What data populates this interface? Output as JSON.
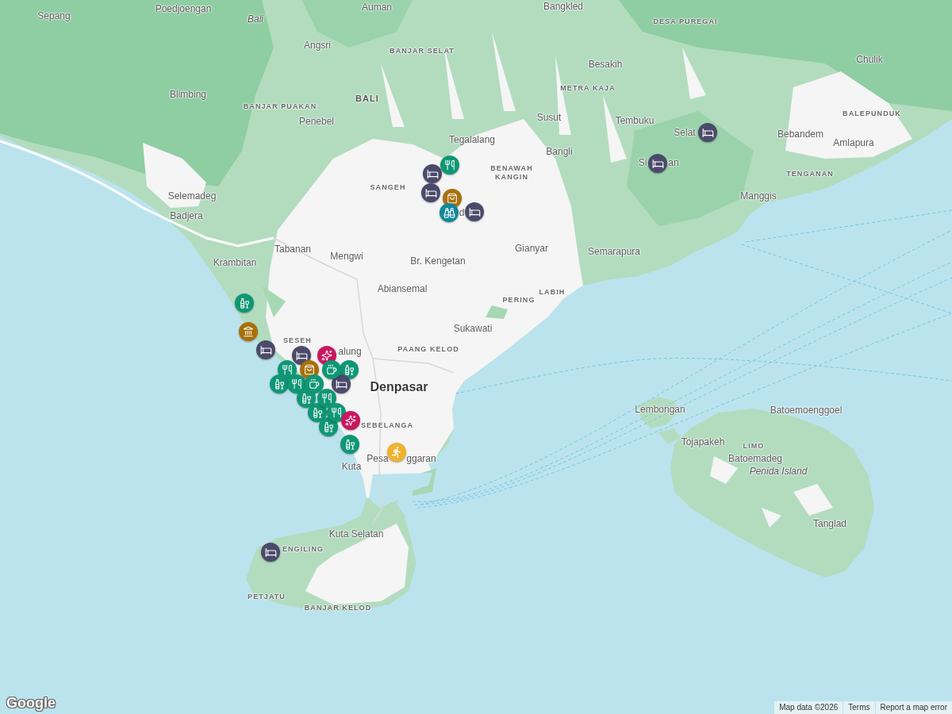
{
  "map": {
    "labels": [
      {
        "text": "Sepang",
        "kind": "town"
      },
      {
        "text": "Poedjoengan",
        "kind": "town"
      },
      {
        "text": "Bali",
        "kind": "region"
      },
      {
        "text": "Auman",
        "kind": "town"
      },
      {
        "text": "Bangkled",
        "kind": "town"
      },
      {
        "text": "DESA PUREGAI",
        "kind": "district"
      },
      {
        "text": "Angsri",
        "kind": "town"
      },
      {
        "text": "BANJAR SELAT",
        "kind": "district"
      },
      {
        "text": "Besakih",
        "kind": "town"
      },
      {
        "text": "Chulik",
        "kind": "town"
      },
      {
        "text": "Blimbing",
        "kind": "town"
      },
      {
        "text": "BANJAR PUAKAN",
        "kind": "district"
      },
      {
        "text": "BALI",
        "kind": "area"
      },
      {
        "text": "METRA KAJA",
        "kind": "district"
      },
      {
        "text": "Penebel",
        "kind": "town"
      },
      {
        "text": "Susut",
        "kind": "town"
      },
      {
        "text": "Tembuku",
        "kind": "town"
      },
      {
        "text": "BALEPUNDUK",
        "kind": "district"
      },
      {
        "text": "Tegalalang",
        "kind": "town"
      },
      {
        "text": "Bangli",
        "kind": "town"
      },
      {
        "text": "Selat",
        "kind": "town"
      },
      {
        "text": "Bebandem",
        "kind": "town"
      },
      {
        "text": "Amlapura",
        "kind": "town"
      },
      {
        "text": "BENAWAH KANGIN",
        "kind": "district"
      },
      {
        "text": "Si",
        "kind": "town"
      },
      {
        "text": "an",
        "kind": "town"
      },
      {
        "text": "TENGANAN",
        "kind": "district"
      },
      {
        "text": "Selemadeg",
        "kind": "town"
      },
      {
        "text": "SANGEH",
        "kind": "district"
      },
      {
        "text": "Manggis",
        "kind": "town"
      },
      {
        "text": "Badjera",
        "kind": "town"
      },
      {
        "text": "d",
        "kind": "town"
      },
      {
        "text": "Krambitan",
        "kind": "town"
      },
      {
        "text": "Tabanan",
        "kind": "town"
      },
      {
        "text": "Mengwi",
        "kind": "town"
      },
      {
        "text": "Br. Kengetan",
        "kind": "town"
      },
      {
        "text": "Gianyar",
        "kind": "town"
      },
      {
        "text": "Semarapura",
        "kind": "town"
      },
      {
        "text": "Abiansemal",
        "kind": "town"
      },
      {
        "text": "PERING",
        "kind": "district"
      },
      {
        "text": "LABIH",
        "kind": "district"
      },
      {
        "text": "Sukawati",
        "kind": "town"
      },
      {
        "text": "SESEH",
        "kind": "district"
      },
      {
        "text": "alung",
        "kind": "town"
      },
      {
        "text": "PAANG KELOD",
        "kind": "district"
      },
      {
        "text": "Denpasar",
        "kind": "city"
      },
      {
        "text": "Lembongan",
        "kind": "town"
      },
      {
        "text": "Batoemoenggoel",
        "kind": "town"
      },
      {
        "text": "SEBELANGA",
        "kind": "district"
      },
      {
        "text": "Tojapakeh",
        "kind": "town"
      },
      {
        "text": "LIMO",
        "kind": "district"
      },
      {
        "text": "Kuta",
        "kind": "town"
      },
      {
        "text": "Pesa",
        "kind": "town"
      },
      {
        "text": "ggaran",
        "kind": "town"
      },
      {
        "text": "Batoemadeg",
        "kind": "town"
      },
      {
        "text": "Penida Island",
        "kind": "region"
      },
      {
        "text": "Kuta Selatan",
        "kind": "town"
      },
      {
        "text": "Tanglad",
        "kind": "town"
      },
      {
        "text": "ENGILING",
        "kind": "district"
      },
      {
        "text": "PETJATU",
        "kind": "district"
      },
      {
        "text": "BANJAR KELOD",
        "kind": "district"
      }
    ],
    "markers": [
      {
        "kind": "hotel",
        "color": "#4c4a6b"
      },
      {
        "kind": "hotel",
        "color": "#4c4a6b"
      },
      {
        "kind": "restaurant",
        "color": "#0f9775"
      },
      {
        "kind": "hotel",
        "color": "#4c4a6b"
      },
      {
        "kind": "hotel",
        "color": "#4c4a6b"
      },
      {
        "kind": "shopping",
        "color": "#a8700a"
      },
      {
        "kind": "sightseeing",
        "color": "#13879a"
      },
      {
        "kind": "hotel",
        "color": "#4c4a6b"
      },
      {
        "kind": "bar",
        "color": "#0f9775"
      },
      {
        "kind": "museum",
        "color": "#a8700a"
      },
      {
        "kind": "hotel",
        "color": "#4c4a6b"
      },
      {
        "kind": "hotel",
        "color": "#4c4a6b"
      },
      {
        "kind": "spa",
        "color": "#c8175f"
      },
      {
        "kind": "restaurant",
        "color": "#0f9775"
      },
      {
        "kind": "bar",
        "color": "#0f9775"
      },
      {
        "kind": "shopping",
        "color": "#a8700a"
      },
      {
        "kind": "bar",
        "color": "#0f9775"
      },
      {
        "kind": "hotel",
        "color": "#4c4a6b"
      },
      {
        "kind": "restaurant",
        "color": "#0f9775"
      },
      {
        "kind": "cafe",
        "color": "#0f9775"
      },
      {
        "kind": "cafe",
        "color": "#0f9775"
      },
      {
        "kind": "bar",
        "color": "#0f9775"
      },
      {
        "kind": "bar",
        "color": "#0f9775"
      },
      {
        "kind": "restaurant",
        "color": "#0f9775"
      },
      {
        "kind": "bar",
        "color": "#0f9775"
      },
      {
        "kind": "restaurant",
        "color": "#0f9775"
      },
      {
        "kind": "spa",
        "color": "#c8175f"
      },
      {
        "kind": "bar",
        "color": "#0f9775"
      },
      {
        "kind": "activity",
        "color": "#f0b22e"
      },
      {
        "kind": "hotel",
        "color": "#4c4a6b"
      }
    ]
  },
  "logo": "Google",
  "attribution": {
    "map_data": "Map data ©2026",
    "links": [
      "Terms",
      "Report a map error"
    ]
  }
}
